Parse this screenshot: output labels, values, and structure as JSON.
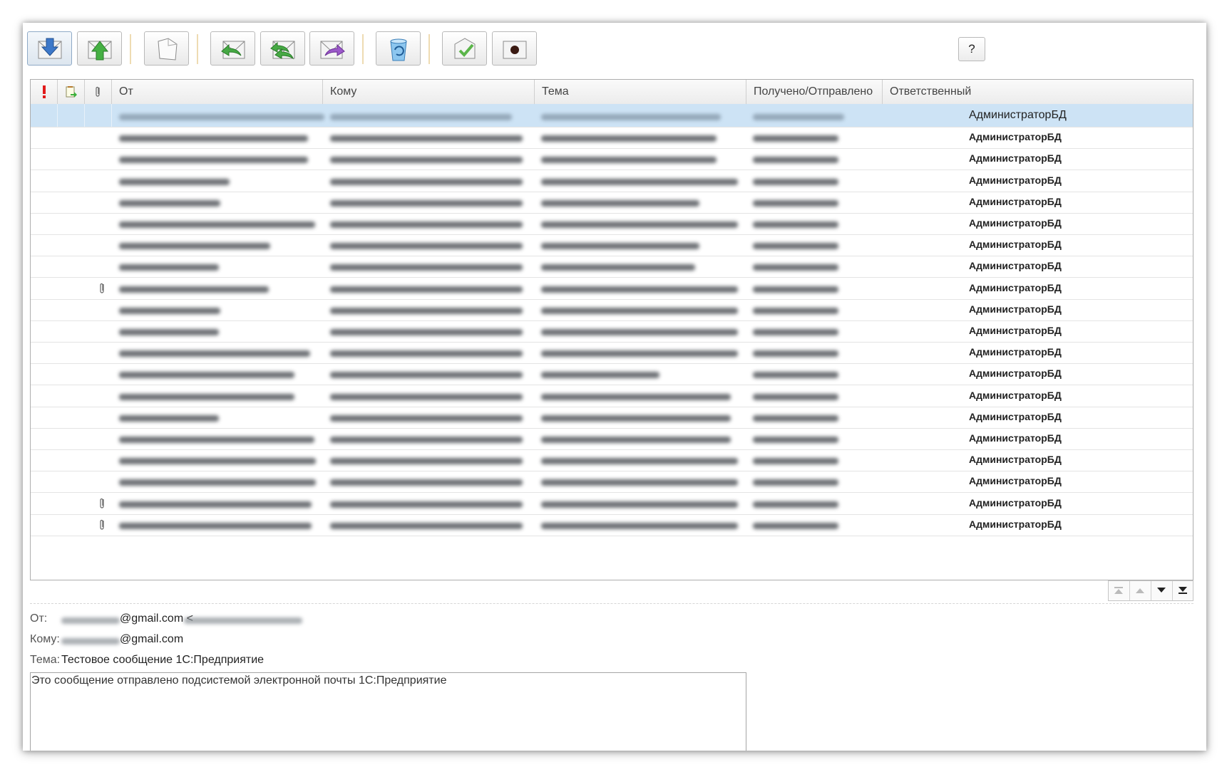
{
  "toolbar": {
    "help_label": "?",
    "buttons": [
      {
        "name": "receive-mail-button",
        "icon": "envelope-down-arrow-icon"
      },
      {
        "name": "send-mail-button",
        "icon": "envelope-up-arrow-icon"
      },
      {
        "name": "new-message-button",
        "icon": "blank-page-icon"
      },
      {
        "name": "reply-button",
        "icon": "envelope-reply-icon"
      },
      {
        "name": "reply-all-button",
        "icon": "envelope-reply-all-icon"
      },
      {
        "name": "forward-button",
        "icon": "envelope-forward-icon"
      },
      {
        "name": "delete-button",
        "icon": "recycle-bin-icon"
      },
      {
        "name": "mark-processed-button",
        "icon": "envelope-check-icon"
      },
      {
        "name": "record-button",
        "icon": "record-dot-icon"
      }
    ]
  },
  "grid": {
    "columns": {
      "importance_icon": "exclamation-icon",
      "processed_icon": "document-arrow-icon",
      "attachment_icon": "paperclip-icon",
      "from": "От",
      "to": "Кому",
      "subject": "Тема",
      "date": "Получено/Отправлено",
      "responsible": "Ответственный"
    },
    "rows": [
      {
        "responsible": "АдминистраторБД",
        "attachment": false,
        "selected": true
      },
      {
        "responsible": "АдминистраторБД",
        "attachment": false,
        "selected": false
      },
      {
        "responsible": "АдминистраторБД",
        "attachment": false,
        "selected": false
      },
      {
        "responsible": "АдминистраторБД",
        "attachment": false,
        "selected": false
      },
      {
        "responsible": "АдминистраторБД",
        "attachment": false,
        "selected": false
      },
      {
        "responsible": "АдминистраторБД",
        "attachment": false,
        "selected": false
      },
      {
        "responsible": "АдминистраторБД",
        "attachment": false,
        "selected": false
      },
      {
        "responsible": "АдминистраторБД",
        "attachment": false,
        "selected": false
      },
      {
        "responsible": "АдминистраторБД",
        "attachment": true,
        "selected": false
      },
      {
        "responsible": "АдминистраторБД",
        "attachment": false,
        "selected": false
      },
      {
        "responsible": "АдминистраторБД",
        "attachment": false,
        "selected": false
      },
      {
        "responsible": "АдминистраторБД",
        "attachment": false,
        "selected": false
      },
      {
        "responsible": "АдминистраторБД",
        "attachment": false,
        "selected": false
      },
      {
        "responsible": "АдминистраторБД",
        "attachment": false,
        "selected": false
      },
      {
        "responsible": "АдминистраторБД",
        "attachment": false,
        "selected": false
      },
      {
        "responsible": "АдминистраторБД",
        "attachment": false,
        "selected": false
      },
      {
        "responsible": "АдминистраторБД",
        "attachment": false,
        "selected": false
      },
      {
        "responsible": "АдминистраторБД",
        "attachment": false,
        "selected": false
      },
      {
        "responsible": "АдминистраторБД",
        "attachment": true,
        "selected": false
      },
      {
        "responsible": "АдминистраторБД",
        "attachment": true,
        "selected": false
      }
    ]
  },
  "navigation": {
    "icons": [
      "first-page-icon",
      "previous-page-icon",
      "next-page-icon",
      "last-page-icon"
    ]
  },
  "preview": {
    "from_label": "От:",
    "from_value_visible": "@gmail.com <",
    "to_label": "Кому:",
    "to_value_visible": "@gmail.com",
    "subject_label": "Тема:",
    "subject_value": "Тестовое сообщение 1С:Предприятие",
    "body_text": "Это сообщение отправлено подсистемой электронной почты 1С:Предприятие"
  },
  "colors": {
    "selection": "#cde3f5",
    "importance": "#e11b1b",
    "separator": "#eedbb2"
  }
}
